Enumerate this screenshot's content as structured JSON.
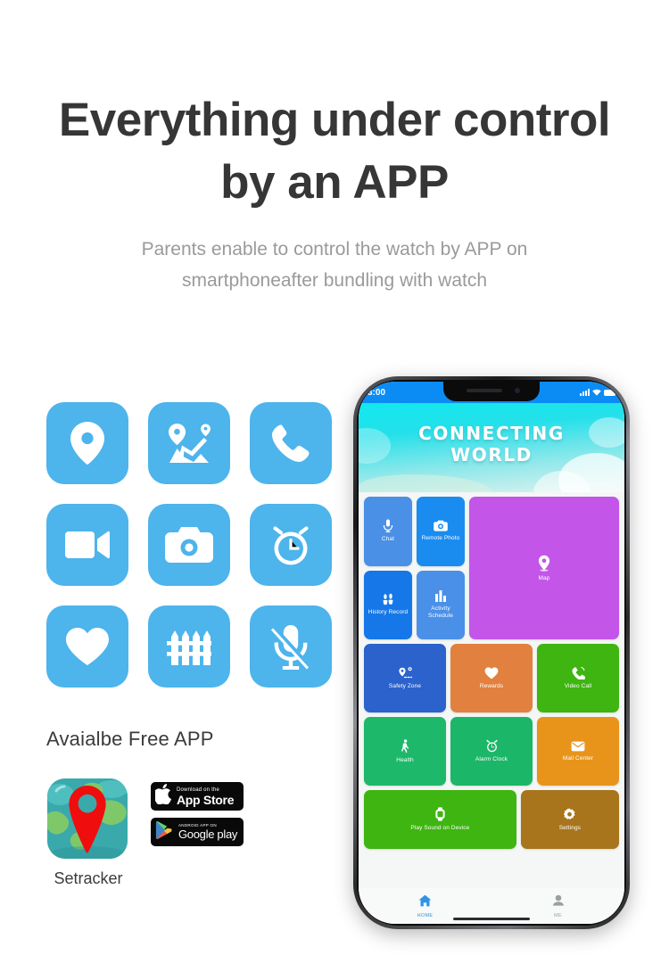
{
  "hero": {
    "headline_line1": "Everything under control",
    "headline_line2": "by an APP",
    "subtitle": "Parents enable to control the watch by APP on smartphoneafter bundling with watch"
  },
  "feature_icons": [
    {
      "name": "location-pin-icon",
      "label": "Location"
    },
    {
      "name": "route-map-icon",
      "label": "Route Tracking"
    },
    {
      "name": "phone-call-icon",
      "label": "Voice Call"
    },
    {
      "name": "video-camera-icon",
      "label": "Video Call"
    },
    {
      "name": "camera-icon",
      "label": "Remote Camera"
    },
    {
      "name": "alarm-clock-icon",
      "label": "Alarm Clock"
    },
    {
      "name": "heart-icon",
      "label": "Health"
    },
    {
      "name": "fence-icon",
      "label": "Safety Fence"
    },
    {
      "name": "microphone-muted-icon",
      "label": "Mute"
    }
  ],
  "free_app": {
    "heading": "Avaialbe Free APP",
    "app_name": "Setracker",
    "app_store_badge": {
      "small": "Download on the",
      "big": "App Store"
    },
    "google_play_badge": {
      "small": "ANDROID APP ON",
      "big": "Google play"
    }
  },
  "phone": {
    "status_bar": {
      "time": "3:00"
    },
    "banner": {
      "line1": "CONNECTING",
      "line2": "WORLD"
    },
    "tiles": [
      {
        "label": "Chat",
        "icon": "microphone-icon",
        "color": "#4a90e6"
      },
      {
        "label": "Remote Photo",
        "icon": "camera-icon",
        "color": "#1a8cef"
      },
      {
        "label": "Map",
        "icon": "map-pin-icon",
        "color": "#c355e8"
      },
      {
        "label": "History Record",
        "icon": "footsteps-icon",
        "color": "#1678e8"
      },
      {
        "label": "Activity Schedule",
        "icon": "bar-chart-icon",
        "color": "#4a90e8"
      },
      {
        "label": "Safety Zone",
        "icon": "geofence-pin-icon",
        "color": "#2b62cc"
      },
      {
        "label": "Rewards",
        "icon": "heart-icon",
        "color": "#e2803f"
      },
      {
        "label": "Video Call",
        "icon": "phone-call-icon",
        "color": "#3eb511"
      },
      {
        "label": "Health",
        "icon": "walking-icon",
        "color": "#1eb86b"
      },
      {
        "label": "Alarm Clock",
        "icon": "alarm-clock-icon",
        "color": "#1cb668"
      },
      {
        "label": "Mail Center",
        "icon": "envelope-icon",
        "color": "#e8941a"
      },
      {
        "label": "Play Sound on Device",
        "icon": "watch-icon",
        "color": "#3eb511"
      },
      {
        "label": "Settings",
        "icon": "gear-icon",
        "color": "#a8751c"
      }
    ],
    "bottom_nav": [
      {
        "label": "HOME",
        "icon": "home-icon",
        "active": true
      },
      {
        "label": "ME",
        "icon": "person-icon",
        "active": false
      }
    ]
  },
  "colors": {
    "icon_blue": "#4db4ec",
    "headline": "#363636",
    "subtitle": "#9a9a9a",
    "status_bar_blue": "#0b8cf4",
    "nav_active": "#2f93e8"
  }
}
